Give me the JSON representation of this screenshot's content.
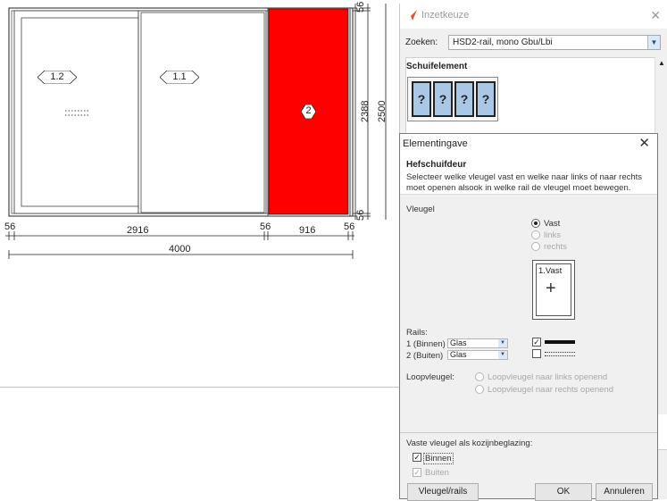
{
  "drawing": {
    "panel_labels": [
      "1.2",
      "1.1",
      "2"
    ],
    "dim_bottom": [
      "56",
      "2916",
      "56",
      "916",
      "56"
    ],
    "dim_total": "4000",
    "dim_right_small_top": "56",
    "dim_right_inner": "2388",
    "dim_right_outer": "2500",
    "dim_right_small_bottom": "56",
    "highlight_color": "#ff0000"
  },
  "inzetkeuze": {
    "title": "Inzetkeuze",
    "close": "✕",
    "zoeken_label": "Zoeken:",
    "zoeken_value": "HSD2-rail, mono Gbu/Lbi",
    "schuifelement_label": "Schuifelement",
    "thumb_cells": [
      "?",
      "?",
      "?",
      "?"
    ]
  },
  "dialog": {
    "title": "Elementingave",
    "close": "✕",
    "header_title": "Hefschuifdeur",
    "header_desc": "Selecteer welke vleugel vast en welke naar links of naar rechts moet openen alsook in welke rail de vleugel moet bewegen.",
    "vleugel_label": "Vleugel",
    "radio_vast": "Vast",
    "radio_links": "links",
    "radio_rechts": "rechts",
    "preview_label": "1.Vast",
    "rails_label": "Rails:",
    "rail1_label": "1 (Binnen)",
    "rail1_value": "Glas",
    "rail2_label": "2 (Buiten)",
    "rail2_value": "Glas",
    "loop_label": "Loopvleugel:",
    "loop_opt1": "Loopvleugel naar links openend",
    "loop_opt2": "Loopvleugel naar rechts openend",
    "vaste_label": "Vaste vleugel als kozijnbeglazing:",
    "binnen_label": "Binnen",
    "buiten_label": "Buiten",
    "btn_vleugel": "Vleugel/rails",
    "btn_ok": "OK",
    "btn_annuleren": "Annuleren"
  }
}
